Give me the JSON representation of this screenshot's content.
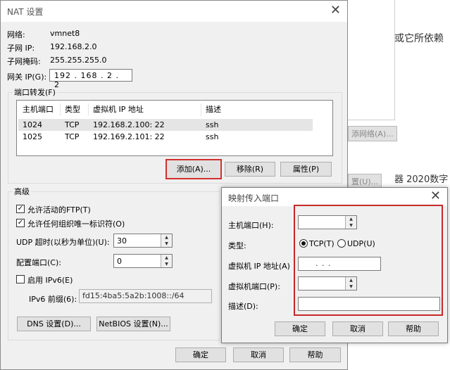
{
  "background": {
    "text_chunk_1": "或它所依赖",
    "text_chunk_2": "器 2020数字",
    "btn_1": "添网络(A)...",
    "btn_2": "置(U)..."
  },
  "nat_dialog": {
    "title": "NAT 设置",
    "network_label": "网络:",
    "network_value": "vmnet8",
    "subnet_ip_label": "子网 IP:",
    "subnet_ip_value": "192.168.2.0",
    "subnet_mask_label": "子网掩码:",
    "subnet_mask_value": "255.255.255.0",
    "gateway_label": "网关 IP(G):",
    "gateway_value": "192 . 168 . 2 . 2",
    "port_forward_legend": "端口转发(F)",
    "table": {
      "headers": [
        "主机端口",
        "类型",
        "虚拟机 IP 地址",
        "描述"
      ],
      "rows": [
        [
          "1024",
          "TCP",
          "192.168.2.100: 22",
          "ssh"
        ],
        [
          "1025",
          "TCP",
          "192.169.2.101: 22",
          "ssh"
        ]
      ]
    },
    "add_button": "添加(A)...",
    "remove_button": "移除(R)",
    "properties_button": "属性(P)",
    "advanced_legend": "高级",
    "allow_ftp": "允许活动的FTP(T)",
    "allow_oui": "允许任何组织唯一标识符(O)",
    "udp_timeout_label": "UDP 超时(以秒为单位)(U):",
    "udp_timeout_value": "30",
    "config_port_label": "配置端口(C):",
    "config_port_value": "0",
    "enable_ipv6": "启用 IPv6(E)",
    "ipv6_prefix_label": "IPv6 前缀(6):",
    "ipv6_prefix_value": "fd15:4ba5:5a2b:1008::/64",
    "dns_button": "DNS 设置(D)...",
    "netbios_button": "NetBIOS 设置(N)...",
    "ok_button": "确定",
    "cancel_button": "取消",
    "help_button": "帮助"
  },
  "map_dialog": {
    "title": "映射传入端口",
    "host_port_label": "主机端口(H):",
    "type_label": "类型:",
    "tcp_label": "TCP(T)",
    "udp_label": "UDP(U)",
    "vm_ip_label": "虚拟机 IP 地址(A)",
    "vm_ip_placeholder": ".     .     .",
    "vm_port_label": "虚拟机端口(P):",
    "desc_label": "描述(D):",
    "ok_button": "确定",
    "cancel_button": "取消",
    "help_button": "帮助"
  },
  "colors": {
    "highlight_red": "#c62828"
  }
}
